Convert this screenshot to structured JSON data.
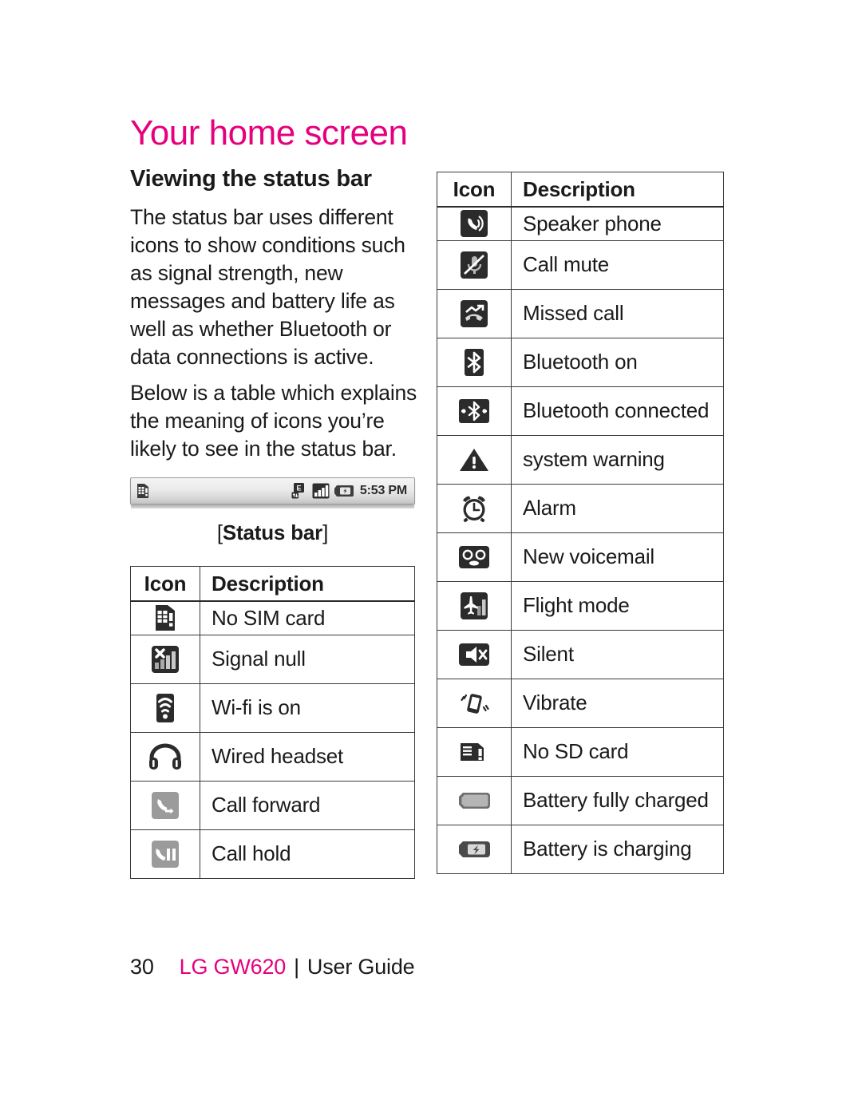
{
  "page": {
    "title": "Your home screen",
    "section_heading": "Viewing the status bar",
    "paragraphs": [
      "The status bar uses different icons to show conditions such as signal strength, new messages and battery life as well as whether Bluetooth or data connections is active.",
      "Below is a table which explains the meaning of icons you’re likely to see in the status bar."
    ],
    "accent_color": "#E5007D"
  },
  "status_bar_figure": {
    "caption_open": "[",
    "caption_label": "Status bar",
    "caption_close": "]",
    "time": "5:53 PM",
    "left_icons": [
      "no-sim-card-icon"
    ],
    "right_icons": [
      "edge-data-icon",
      "signal-bars-icon",
      "battery-charging-icon"
    ]
  },
  "left_table": {
    "headers": {
      "icon": "Icon",
      "description": "Description"
    },
    "rows": [
      {
        "icon": "no-sim-card-icon",
        "description": "No SIM card"
      },
      {
        "icon": "signal-null-icon",
        "description": "Signal null"
      },
      {
        "icon": "wifi-on-icon",
        "description": "Wi-fi is on"
      },
      {
        "icon": "wired-headset-icon",
        "description": "Wired headset"
      },
      {
        "icon": "call-forward-icon",
        "description": "Call forward"
      },
      {
        "icon": "call-hold-icon",
        "description": "Call hold"
      }
    ]
  },
  "right_table": {
    "headers": {
      "icon": "Icon",
      "description": "Description"
    },
    "rows": [
      {
        "icon": "speaker-phone-icon",
        "description": "Speaker phone"
      },
      {
        "icon": "call-mute-icon",
        "description": "Call mute"
      },
      {
        "icon": "missed-call-icon",
        "description": "Missed call"
      },
      {
        "icon": "bluetooth-on-icon",
        "description": "Bluetooth on"
      },
      {
        "icon": "bluetooth-connected-icon",
        "description": "Bluetooth connected"
      },
      {
        "icon": "system-warning-icon",
        "description": " system warning"
      },
      {
        "icon": "alarm-icon",
        "description": "Alarm"
      },
      {
        "icon": "new-voicemail-icon",
        "description": "New voicemail"
      },
      {
        "icon": "flight-mode-icon",
        "description": "Flight mode"
      },
      {
        "icon": "silent-icon",
        "description": "Silent"
      },
      {
        "icon": "vibrate-icon",
        "description": "Vibrate"
      },
      {
        "icon": "no-sd-card-icon",
        "description": "No SD card"
      },
      {
        "icon": "battery-full-icon",
        "description": "Battery fully charged"
      },
      {
        "icon": "battery-charging-icon",
        "description": "Battery is charging"
      }
    ]
  },
  "footer": {
    "page_number": "30",
    "brand": "LG GW620",
    "separator": "|",
    "guide": "User Guide"
  }
}
